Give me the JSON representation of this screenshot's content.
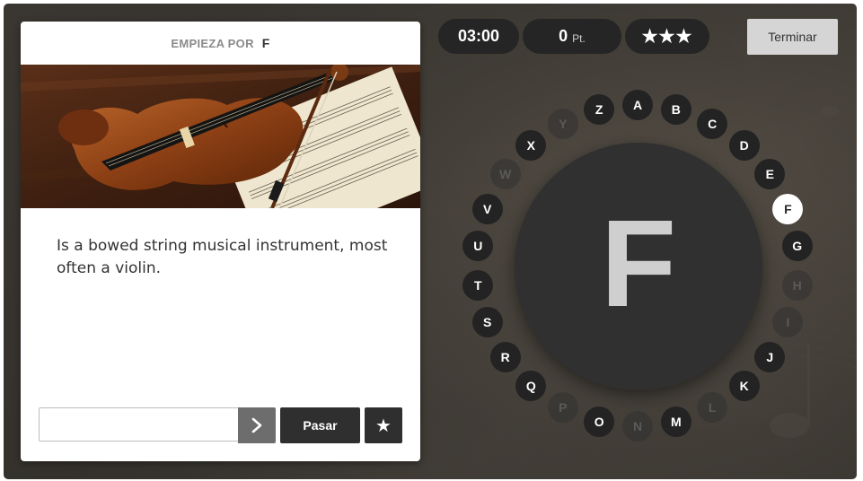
{
  "card": {
    "header_prefix": "EMPIEZA POR",
    "header_letter": "F",
    "definition": "Is a bowed string musical instrument, most often a violin.",
    "answer_value": "",
    "skip_label": "Pasar",
    "star_icon": "★",
    "submit_icon": "chevron-right-icon"
  },
  "stats": {
    "timer": "03:00",
    "points": "0",
    "points_unit": "Pt.",
    "stars": "★★★"
  },
  "finish_label": "Terminar",
  "current_letter": "F",
  "letters": [
    {
      "letter": "A",
      "state": "normal"
    },
    {
      "letter": "B",
      "state": "normal"
    },
    {
      "letter": "C",
      "state": "normal"
    },
    {
      "letter": "D",
      "state": "normal"
    },
    {
      "letter": "E",
      "state": "normal"
    },
    {
      "letter": "F",
      "state": "active"
    },
    {
      "letter": "G",
      "state": "normal"
    },
    {
      "letter": "H",
      "state": "faded"
    },
    {
      "letter": "I",
      "state": "faded"
    },
    {
      "letter": "J",
      "state": "normal"
    },
    {
      "letter": "K",
      "state": "normal"
    },
    {
      "letter": "L",
      "state": "faded"
    },
    {
      "letter": "M",
      "state": "normal"
    },
    {
      "letter": "N",
      "state": "faded"
    },
    {
      "letter": "O",
      "state": "normal"
    },
    {
      "letter": "P",
      "state": "faded"
    },
    {
      "letter": "Q",
      "state": "normal"
    },
    {
      "letter": "R",
      "state": "normal"
    },
    {
      "letter": "S",
      "state": "normal"
    },
    {
      "letter": "T",
      "state": "normal"
    },
    {
      "letter": "U",
      "state": "normal"
    },
    {
      "letter": "V",
      "state": "normal"
    },
    {
      "letter": "W",
      "state": "faded"
    },
    {
      "letter": "X",
      "state": "normal"
    },
    {
      "letter": "Y",
      "state": "faded"
    },
    {
      "letter": "Z",
      "state": "normal"
    }
  ],
  "colors": {
    "letter_bg": "#232323",
    "letter_active_bg": "#ffffff",
    "letter_faded_text": "#5a5a5a",
    "button_dark": "#2f2f2f",
    "submit_gray": "#6d6d6d",
    "finish_bg": "#d5d5d5"
  }
}
